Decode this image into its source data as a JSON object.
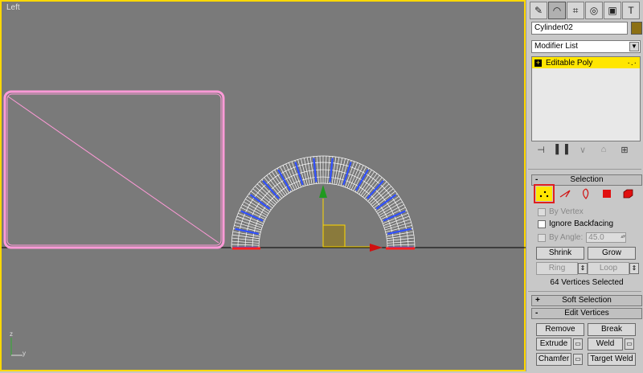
{
  "viewport": {
    "label": "Left"
  },
  "panel": {
    "tabs": [
      {
        "icon": "create-icon",
        "glyph": "✎"
      },
      {
        "icon": "modify-icon",
        "glyph": "◠"
      },
      {
        "icon": "hierarchy-icon",
        "glyph": "⌗"
      },
      {
        "icon": "motion-icon",
        "glyph": "◎"
      },
      {
        "icon": "display-icon",
        "glyph": "▣"
      },
      {
        "icon": "utilities-icon",
        "glyph": "T"
      }
    ],
    "object_name": "Cylinder02",
    "object_color": "#8c7014",
    "modifier_list": "Modifier List",
    "stack_item": "Editable Poly",
    "selection_title": "Selection",
    "selection_sign": "-",
    "by_vertex": "By Vertex",
    "ignore_backfacing": "Ignore Backfacing",
    "by_angle": "By Angle:",
    "angle_value": "45.0",
    "shrink": "Shrink",
    "grow": "Grow",
    "ring": "Ring",
    "loop": "Loop",
    "status": "64 Vertices Selected",
    "soft_selection_title": "Soft Selection",
    "soft_sign": "+",
    "edit_vertices_title": "Edit Vertices",
    "edit_sign": "-",
    "remove": "Remove",
    "break": "Break",
    "extrude": "Extrude",
    "weld": "Weld",
    "chamfer": "Chamfer",
    "target_weld": "Target Weld",
    "accent": "#ffe600"
  }
}
